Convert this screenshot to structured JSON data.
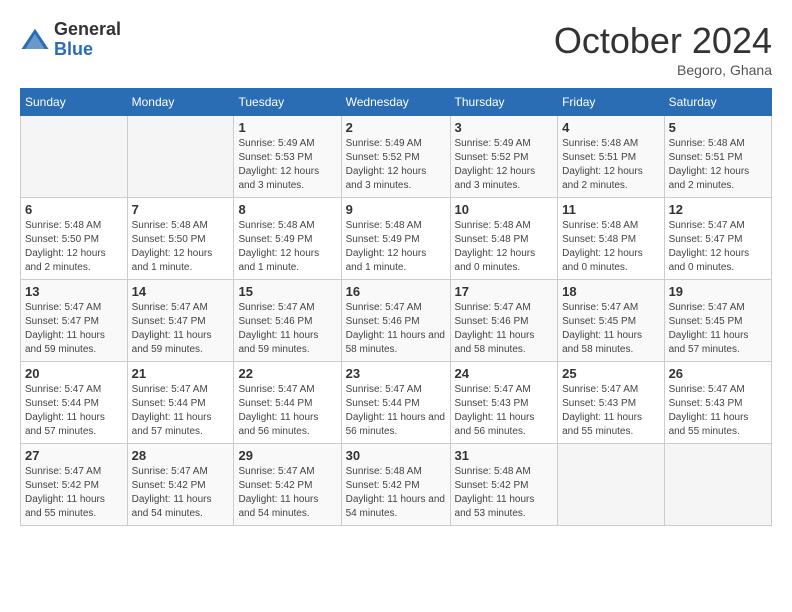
{
  "logo": {
    "general": "General",
    "blue": "Blue"
  },
  "header": {
    "month_title": "October 2024",
    "location": "Begoro, Ghana"
  },
  "weekdays": [
    "Sunday",
    "Monday",
    "Tuesday",
    "Wednesday",
    "Thursday",
    "Friday",
    "Saturday"
  ],
  "weeks": [
    [
      {
        "day": "",
        "info": ""
      },
      {
        "day": "",
        "info": ""
      },
      {
        "day": "1",
        "info": "Sunrise: 5:49 AM\nSunset: 5:53 PM\nDaylight: 12 hours and 3 minutes."
      },
      {
        "day": "2",
        "info": "Sunrise: 5:49 AM\nSunset: 5:52 PM\nDaylight: 12 hours and 3 minutes."
      },
      {
        "day": "3",
        "info": "Sunrise: 5:49 AM\nSunset: 5:52 PM\nDaylight: 12 hours and 3 minutes."
      },
      {
        "day": "4",
        "info": "Sunrise: 5:48 AM\nSunset: 5:51 PM\nDaylight: 12 hours and 2 minutes."
      },
      {
        "day": "5",
        "info": "Sunrise: 5:48 AM\nSunset: 5:51 PM\nDaylight: 12 hours and 2 minutes."
      }
    ],
    [
      {
        "day": "6",
        "info": "Sunrise: 5:48 AM\nSunset: 5:50 PM\nDaylight: 12 hours and 2 minutes."
      },
      {
        "day": "7",
        "info": "Sunrise: 5:48 AM\nSunset: 5:50 PM\nDaylight: 12 hours and 1 minute."
      },
      {
        "day": "8",
        "info": "Sunrise: 5:48 AM\nSunset: 5:49 PM\nDaylight: 12 hours and 1 minute."
      },
      {
        "day": "9",
        "info": "Sunrise: 5:48 AM\nSunset: 5:49 PM\nDaylight: 12 hours and 1 minute."
      },
      {
        "day": "10",
        "info": "Sunrise: 5:48 AM\nSunset: 5:48 PM\nDaylight: 12 hours and 0 minutes."
      },
      {
        "day": "11",
        "info": "Sunrise: 5:48 AM\nSunset: 5:48 PM\nDaylight: 12 hours and 0 minutes."
      },
      {
        "day": "12",
        "info": "Sunrise: 5:47 AM\nSunset: 5:47 PM\nDaylight: 12 hours and 0 minutes."
      }
    ],
    [
      {
        "day": "13",
        "info": "Sunrise: 5:47 AM\nSunset: 5:47 PM\nDaylight: 11 hours and 59 minutes."
      },
      {
        "day": "14",
        "info": "Sunrise: 5:47 AM\nSunset: 5:47 PM\nDaylight: 11 hours and 59 minutes."
      },
      {
        "day": "15",
        "info": "Sunrise: 5:47 AM\nSunset: 5:46 PM\nDaylight: 11 hours and 59 minutes."
      },
      {
        "day": "16",
        "info": "Sunrise: 5:47 AM\nSunset: 5:46 PM\nDaylight: 11 hours and 58 minutes."
      },
      {
        "day": "17",
        "info": "Sunrise: 5:47 AM\nSunset: 5:46 PM\nDaylight: 11 hours and 58 minutes."
      },
      {
        "day": "18",
        "info": "Sunrise: 5:47 AM\nSunset: 5:45 PM\nDaylight: 11 hours and 58 minutes."
      },
      {
        "day": "19",
        "info": "Sunrise: 5:47 AM\nSunset: 5:45 PM\nDaylight: 11 hours and 57 minutes."
      }
    ],
    [
      {
        "day": "20",
        "info": "Sunrise: 5:47 AM\nSunset: 5:44 PM\nDaylight: 11 hours and 57 minutes."
      },
      {
        "day": "21",
        "info": "Sunrise: 5:47 AM\nSunset: 5:44 PM\nDaylight: 11 hours and 57 minutes."
      },
      {
        "day": "22",
        "info": "Sunrise: 5:47 AM\nSunset: 5:44 PM\nDaylight: 11 hours and 56 minutes."
      },
      {
        "day": "23",
        "info": "Sunrise: 5:47 AM\nSunset: 5:44 PM\nDaylight: 11 hours and 56 minutes."
      },
      {
        "day": "24",
        "info": "Sunrise: 5:47 AM\nSunset: 5:43 PM\nDaylight: 11 hours and 56 minutes."
      },
      {
        "day": "25",
        "info": "Sunrise: 5:47 AM\nSunset: 5:43 PM\nDaylight: 11 hours and 55 minutes."
      },
      {
        "day": "26",
        "info": "Sunrise: 5:47 AM\nSunset: 5:43 PM\nDaylight: 11 hours and 55 minutes."
      }
    ],
    [
      {
        "day": "27",
        "info": "Sunrise: 5:47 AM\nSunset: 5:42 PM\nDaylight: 11 hours and 55 minutes."
      },
      {
        "day": "28",
        "info": "Sunrise: 5:47 AM\nSunset: 5:42 PM\nDaylight: 11 hours and 54 minutes."
      },
      {
        "day": "29",
        "info": "Sunrise: 5:47 AM\nSunset: 5:42 PM\nDaylight: 11 hours and 54 minutes."
      },
      {
        "day": "30",
        "info": "Sunrise: 5:48 AM\nSunset: 5:42 PM\nDaylight: 11 hours and 54 minutes."
      },
      {
        "day": "31",
        "info": "Sunrise: 5:48 AM\nSunset: 5:42 PM\nDaylight: 11 hours and 53 minutes."
      },
      {
        "day": "",
        "info": ""
      },
      {
        "day": "",
        "info": ""
      }
    ]
  ]
}
